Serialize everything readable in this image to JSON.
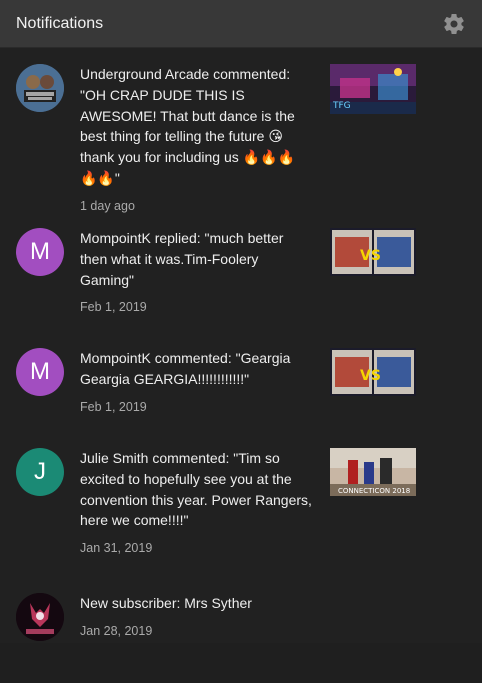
{
  "header": {
    "title": "Notifications"
  },
  "notifications": [
    {
      "avatar_text": "Underground Arcade",
      "avatar_color": "#4a6a8a",
      "message": "Underground Arcade commented: \"OH CRAP DUDE THIS IS AWESOME! That butt dance is the best thing for telling the future 😘 thank you for including us 🔥🔥🔥🔥🔥\"",
      "time": "1 day ago",
      "thumb_text": "TFG"
    },
    {
      "avatar_text": "M",
      "avatar_color": "#a24ec0",
      "message": "MompointK replied: \"much better then what it was.Tim-Foolery Gaming\"",
      "time": "Feb 1, 2019",
      "thumb_text": "VS"
    },
    {
      "avatar_text": "M",
      "avatar_color": "#a24ec0",
      "message": "MompointK commented: \"Geargia Geargia GEARGIA!!!!!!!!!!!!\"",
      "time": "Feb 1, 2019",
      "thumb_text": "VS"
    },
    {
      "avatar_text": "J",
      "avatar_color": "#1b8a75",
      "message": "Julie Smith commented: \"Tim so excited to hopefully see you at the convention this year. Power Rangers, here we come!!!!\"",
      "time": "Jan 31, 2019",
      "thumb_text": "CONNECTICON 2018"
    },
    {
      "avatar_text": "Mrs Syther",
      "avatar_color": "#1a0a10",
      "message": "New subscriber: Mrs Syther",
      "time": "Jan 28, 2019",
      "thumb_text": ""
    }
  ]
}
